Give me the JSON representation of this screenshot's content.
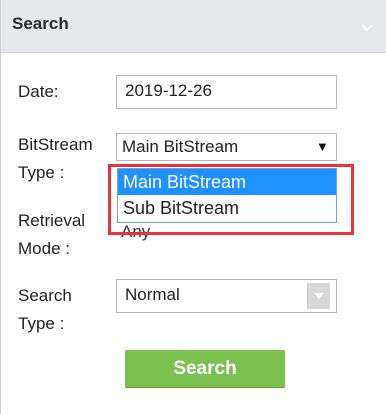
{
  "panel": {
    "title": "Search"
  },
  "date": {
    "label": "Date:",
    "value": "2019-12-26"
  },
  "bitstream": {
    "label_line1": "BitStream",
    "label_line2": "Type :",
    "selected": "Main BitStream",
    "options": [
      "Main BitStream",
      "Sub BitStream"
    ]
  },
  "retrieval": {
    "label_line1": "Retrieval",
    "label_line2": "Mode :",
    "partial_value": "Any"
  },
  "search_type": {
    "label_line1": "Search",
    "label_line2": "Type :",
    "selected": "Normal"
  },
  "actions": {
    "search_label": "Search"
  },
  "colors": {
    "header_bg": "#e6e8eb",
    "selected_option": "#1e90ff",
    "highlight": "#e8323c",
    "button": "#7cc14f"
  }
}
